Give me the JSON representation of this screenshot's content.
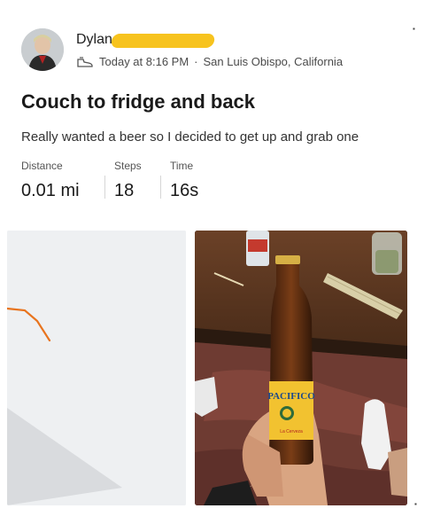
{
  "post": {
    "username": "Dylan",
    "timestamp": "Today at 8:16 PM",
    "separator": "·",
    "location": "San Luis Obispo, California",
    "activity_icon": "walking-shoe-icon",
    "title": "Couch to fridge and back",
    "description": "Really wanted a beer so I decided to get up and grab one"
  },
  "stats": {
    "distance_label": "Distance",
    "distance_value": "0.01 mi",
    "steps_label": "Steps",
    "steps_value": "18",
    "time_label": "Time",
    "time_value": "16s"
  },
  "bottle_label": {
    "brand": "PACIFICO",
    "sub": "La Cerveza"
  },
  "colors": {
    "route": "#e8741e",
    "redaction": "#f7c31e",
    "map_background": "#eef0f2",
    "bottle_label": "#f2c230"
  }
}
